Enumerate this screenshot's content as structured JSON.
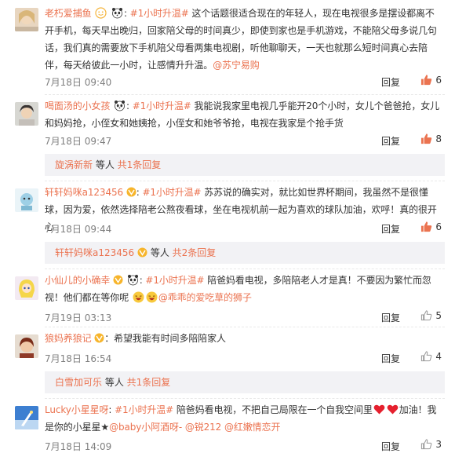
{
  "comments": [
    {
      "user": "老朽爱捕鱼",
      "hashtag": "#1小时升温#",
      "text": " 这个话题很适合现在的年轻人，现在电视很多是摆设都离不开手机，每天早出晚归，回家陪父母的时间真少，即使到家也是手机游戏，不能陪父母多说几句话，我们真的需要放下手机陪父母看两集电视剧，听他聊聊天，一天也就那么短时间真心去陪伴，每天给彼此一小时，让感情升升温。",
      "mention": "@苏宁易购",
      "time": "7月18日 09:40",
      "reply_label": "回复",
      "likes": "6",
      "liked": true
    },
    {
      "user": "喝面汤的小女孩",
      "hashtag": "#1小时升温#",
      "text": " 我能说我家里电视几乎能开20个小时，女儿个爸爸抢，女儿和妈妈抢，小侄女和她姨抢，小侄女和她爷爷抢，电视在我家是个抢手货",
      "time": "7月18日 09:47",
      "reply_label": "回复",
      "likes": "8",
      "liked": true,
      "sub": {
        "user": "旋涡新新",
        "mid": " 等人 ",
        "count": "共1条回复"
      }
    },
    {
      "user": "轩轩妈咪a123456",
      "hashtag": "#1小时升温#",
      "text": " 苏苏说的确实对，就比如世界杯期间，我虽然不是很懂球，因为爱，依然选择陪老公熬夜看球，坐在电视机前一起为喜欢的球队加油，欢呼！真的很开心",
      "time": "7月18日 09:44",
      "reply_label": "回复",
      "likes": "6",
      "liked": true,
      "sub": {
        "user": "轩轩妈咪a123456",
        "mid": " 等人 ",
        "count": "共2条回复"
      }
    },
    {
      "user": "小仙儿的小确幸",
      "hashtag": "#1小时升温#",
      "text": " 陪爸妈看电视，多陪陪老人才是真！不要因为繁忙而忽视！他们都在等你呢",
      "mention": "@乖乖的爱吃草的狮子",
      "time": "7月19日 03:13",
      "reply_label": "回复",
      "likes": "5",
      "liked": false
    },
    {
      "user": "狼妈养狼记",
      "text": "：希望我能有时间多陪陪家人",
      "time": "7月18日 16:54",
      "reply_label": "回复",
      "likes": "4",
      "liked": false,
      "sub": {
        "user": "白雪加可乐",
        "mid": " 等人 ",
        "count": "共1条回复"
      }
    },
    {
      "user": "Lucky小星星呀",
      "hashtag": "#1小时升温#",
      "text": " 陪爸妈看电视，不把自己局限在一个自我空间里",
      "text2": "加油！我是你的小星星★",
      "mention": "@baby小阿酒呀-",
      "mention2": "@锐212",
      "mention3": "@红嫩情恋开",
      "time": "7月18日 14:09",
      "reply_label": "回复",
      "likes": "3",
      "liked": false
    }
  ],
  "icons": {
    "like": "thumbs-up-icon",
    "vip": "vip-badge-icon",
    "panda": "panda-emoji-icon",
    "laugh": "laughing-face-icon",
    "heart": "red-heart-icon"
  },
  "colors": {
    "accent": "#eb7350",
    "liked": "#eb7350",
    "unliked": "#9a9a9a",
    "sub_bg": "#f2f2f5"
  }
}
